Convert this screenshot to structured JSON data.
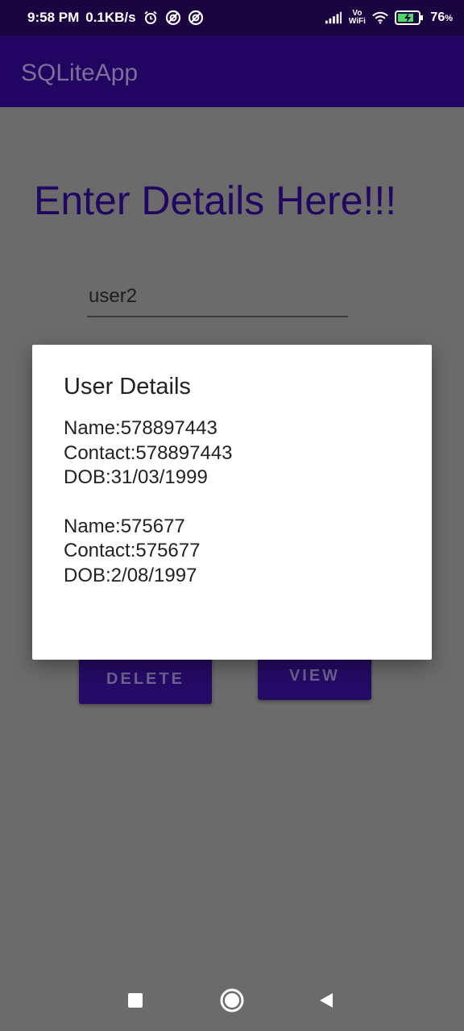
{
  "status_bar": {
    "time": "9:58 PM",
    "network_speed": "0.1KB/s",
    "volte_label_top": "Vo",
    "volte_label_bottom": "WiFi",
    "battery_percent": "76"
  },
  "app_bar": {
    "title": "SQLiteApp"
  },
  "main": {
    "heading": "Enter Details Here!!!",
    "name_field_value": "user2",
    "buttons": {
      "delete": "DELETE",
      "view": "VIEW"
    }
  },
  "dialog": {
    "title": "User Details",
    "records": [
      {
        "name": "Name:578897443",
        "contact": "Contact:578897443",
        "dob": "DOB:31/03/1999"
      },
      {
        "name": "Name:575677",
        "contact": "Contact:575677",
        "dob": "DOB:2/08/1997"
      }
    ]
  },
  "colors": {
    "status_bar": "#1a0540",
    "app_bar": "#210561",
    "scrim_background": "#6b6b6b",
    "dialog_background": "#ffffff",
    "heading_text": "#200862",
    "button_background": "#250a66"
  },
  "icons": {
    "status_left": [
      "alarm-icon",
      "vpn-icon",
      "vpn-icon"
    ],
    "status_right": [
      "signal-icon",
      "volte-wifi-icon",
      "wifi-icon",
      "battery-icon"
    ],
    "navigation": [
      "recents-icon",
      "home-icon",
      "back-icon"
    ]
  }
}
